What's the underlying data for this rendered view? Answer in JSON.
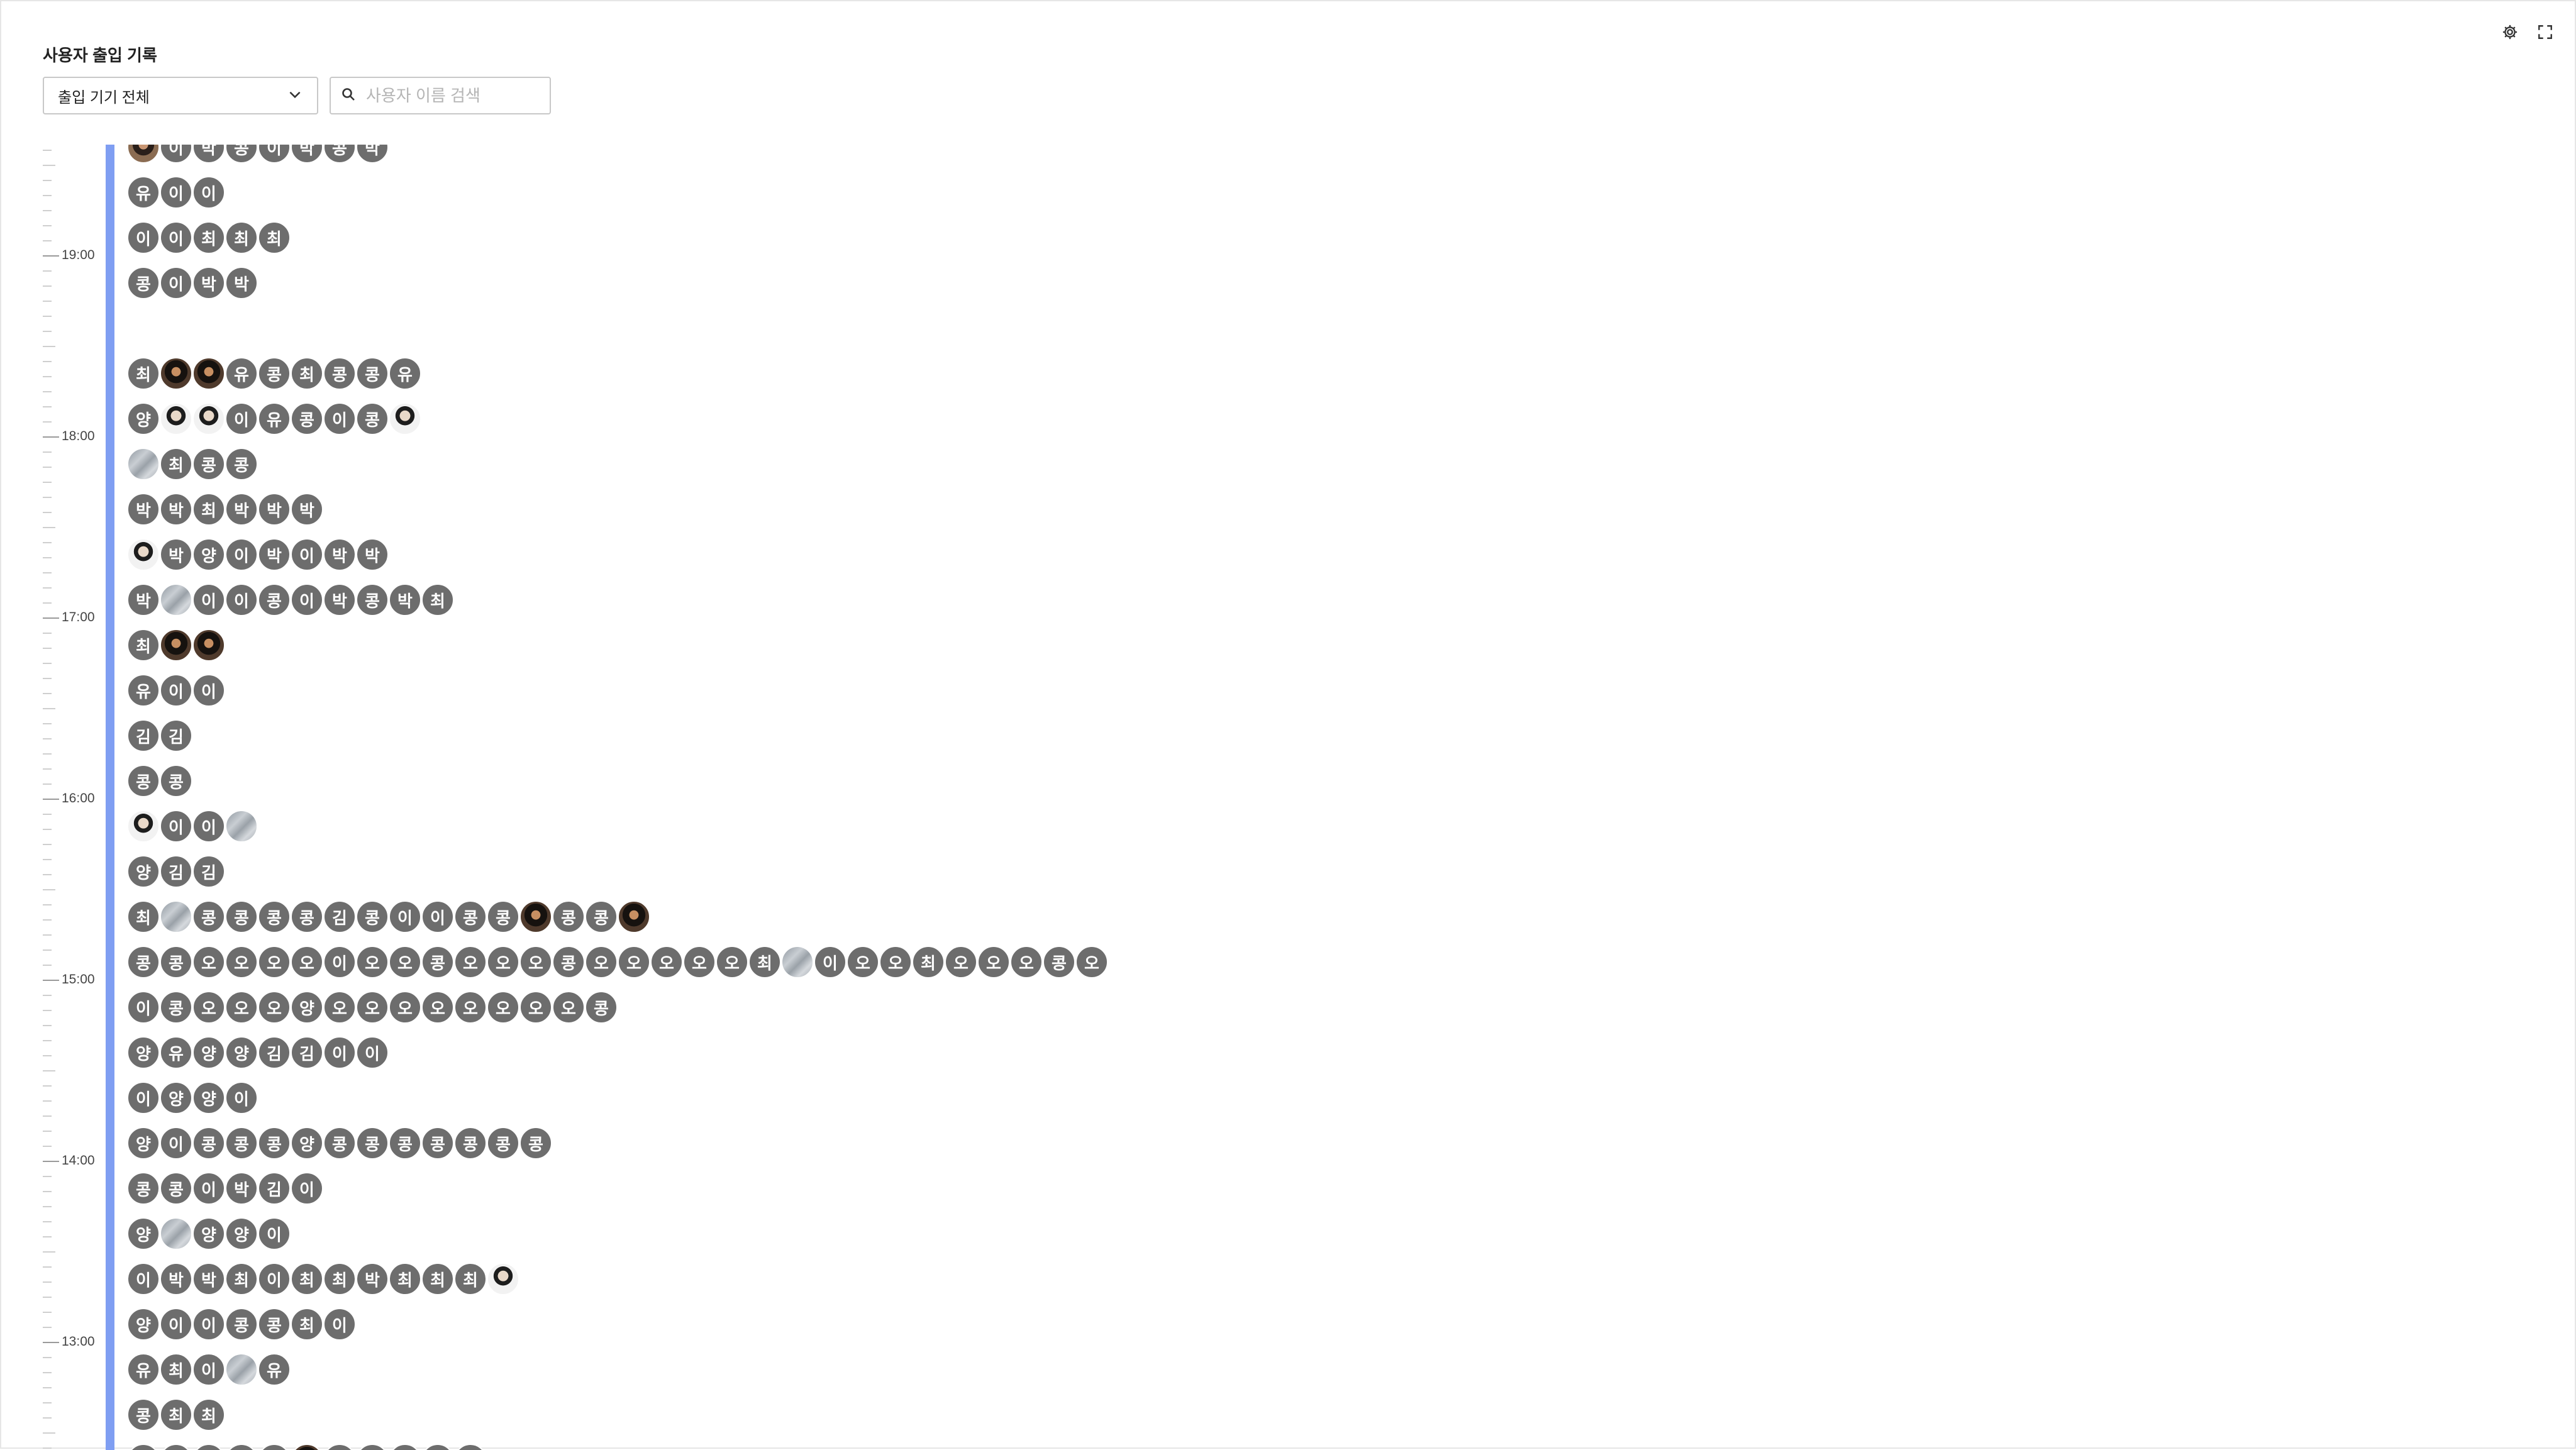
{
  "header": {
    "title": "사용자 출입 기록"
  },
  "top_icons": [
    {
      "name": "gear-icon"
    },
    {
      "name": "fullscreen-icon"
    }
  ],
  "filters": {
    "device_select": {
      "value": "출입 기기 전체",
      "icon": "chevron-down-icon"
    },
    "search": {
      "placeholder": "사용자 이름 검색",
      "value": "",
      "icon": "search-icon"
    }
  },
  "timeline": {
    "hour_labels": [
      "19:00",
      "18:00",
      "17:00",
      "16:00",
      "15:00",
      "14:00",
      "13:00"
    ],
    "accent_color": "#7f9ef2",
    "rows": [
      [
        "A",
        "이",
        "박",
        "콩",
        "이",
        "박",
        "콩",
        "박"
      ],
      [
        "유",
        "이",
        "이"
      ],
      [
        "이",
        "이",
        "최",
        "최",
        "최"
      ],
      [
        "콩",
        "이",
        "박",
        "박"
      ],
      [],
      [
        "최",
        "B",
        "B",
        "유",
        "콩",
        "최",
        "콩",
        "콩",
        "유"
      ],
      [
        "양",
        "P",
        "P",
        "이",
        "유",
        "콩",
        "이",
        "콩",
        "P"
      ],
      [
        "G",
        "최",
        "콩",
        "콩"
      ],
      [
        "박",
        "박",
        "최",
        "박",
        "박",
        "박"
      ],
      [
        "P",
        "박",
        "양",
        "이",
        "박",
        "이",
        "박",
        "박"
      ],
      [
        "박",
        "G",
        "이",
        "이",
        "콩",
        "이",
        "박",
        "콩",
        "박",
        "최"
      ],
      [
        "최",
        "B",
        "B"
      ],
      [
        "유",
        "이",
        "이"
      ],
      [
        "김",
        "김"
      ],
      [
        "콩",
        "콩"
      ],
      [
        "P",
        "이",
        "이",
        "G"
      ],
      [
        "양",
        "김",
        "김"
      ],
      [
        "최",
        "G",
        "콩",
        "콩",
        "콩",
        "콩",
        "김",
        "콩",
        "이",
        "이",
        "콩",
        "콩",
        "B",
        "콩",
        "콩",
        "B"
      ],
      [
        "콩",
        "콩",
        "오",
        "오",
        "오",
        "오",
        "이",
        "오",
        "오",
        "콩",
        "오",
        "오",
        "오",
        "콩",
        "오",
        "오",
        "오",
        "오",
        "오",
        "최",
        "G",
        "이",
        "오",
        "오",
        "최",
        "오",
        "오",
        "오",
        "콩",
        "오"
      ],
      [
        "이",
        "콩",
        "오",
        "오",
        "오",
        "양",
        "오",
        "오",
        "오",
        "오",
        "오",
        "오",
        "오",
        "오",
        "콩"
      ],
      [
        "양",
        "유",
        "양",
        "양",
        "김",
        "김",
        "이",
        "이"
      ],
      [
        "이",
        "양",
        "양",
        "이"
      ],
      [
        "양",
        "이",
        "콩",
        "콩",
        "콩",
        "양",
        "콩",
        "콩",
        "콩",
        "콩",
        "콩",
        "콩",
        "콩"
      ],
      [
        "콩",
        "콩",
        "이",
        "박",
        "김",
        "이"
      ],
      [
        "양",
        "G",
        "양",
        "양",
        "이"
      ],
      [
        "이",
        "박",
        "박",
        "최",
        "이",
        "최",
        "최",
        "박",
        "최",
        "최",
        "최",
        "P"
      ],
      [
        "양",
        "이",
        "이",
        "콩",
        "콩",
        "최",
        "이"
      ],
      [
        "유",
        "최",
        "이",
        "G",
        "유"
      ],
      [
        "콩",
        "최",
        "최"
      ],
      [
        "박",
        "박",
        "양",
        "박",
        "박",
        "C",
        "김",
        "이",
        "오",
        "이",
        "김"
      ]
    ]
  }
}
